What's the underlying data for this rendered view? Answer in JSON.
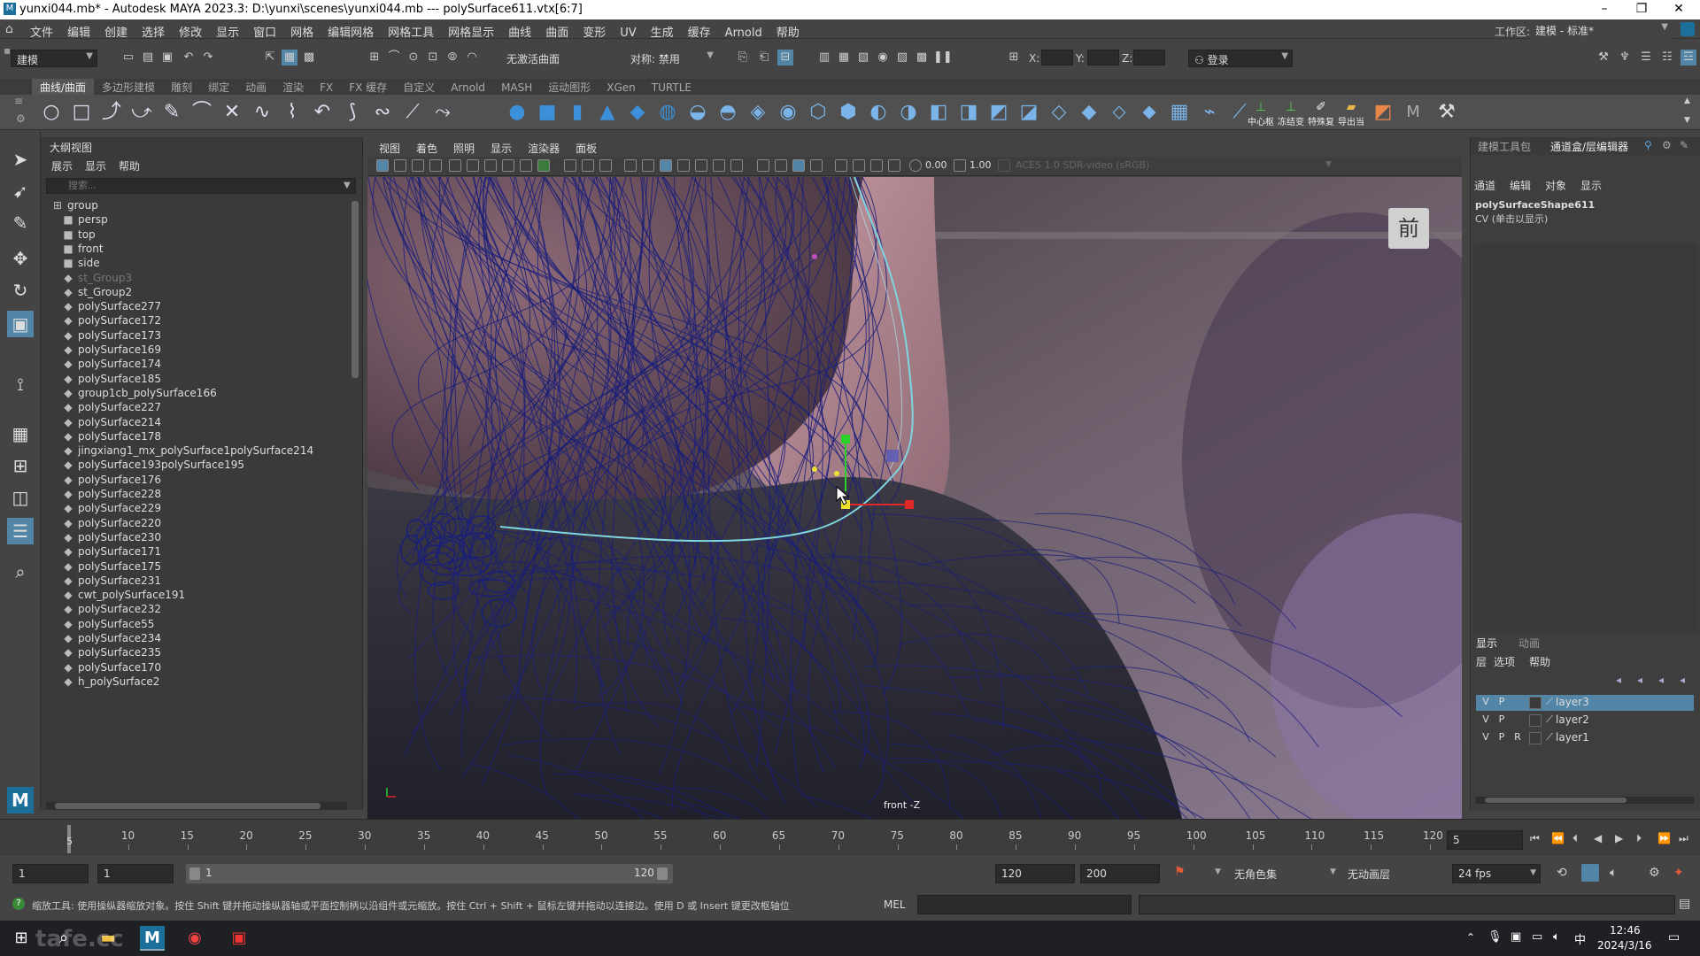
{
  "titlebar": {
    "title": "yunxi044.mb* - Autodesk MAYA 2023.3: D:\\yunxi\\scenes\\yunxi044.mb   ---   polySurface611.vtx[6:7]",
    "minimize": "–",
    "restore": "❐",
    "close": "✕"
  },
  "menubar": {
    "items": [
      "文件",
      "编辑",
      "创建",
      "选择",
      "修改",
      "显示",
      "窗口",
      "网格",
      "编辑网格",
      "网格工具",
      "网格显示",
      "曲线",
      "曲面",
      "变形",
      "UV",
      "生成",
      "缓存",
      "Arnold",
      "帮助"
    ],
    "workspace_label": "工作区:",
    "workspace_value": "建模 - 标准*"
  },
  "statusline": {
    "mode": "建模",
    "live_surface": "无激活曲面",
    "symmetry": "对称: 禁用",
    "x_label": "X:",
    "y_label": "Y:",
    "z_label": "Z:",
    "login": "登录"
  },
  "shelf_tabs": [
    "曲线/曲面",
    "多边形建模",
    "雕刻",
    "绑定",
    "动画",
    "渲染",
    "FX",
    "FX 缓存",
    "自定义",
    "Arnold",
    "MASH",
    "运动图形",
    "XGen",
    "TURTLE"
  ],
  "shelf_text_buttons": [
    "中心枢",
    "冻结变",
    "特殊复",
    "导出当"
  ],
  "outliner": {
    "title": "大纲视图",
    "menu": [
      "展示",
      "显示",
      "帮助"
    ],
    "search_placeholder": "搜索...",
    "rows": [
      {
        "label": "group",
        "type": "group"
      },
      {
        "label": "persp",
        "type": "camera"
      },
      {
        "label": "top",
        "type": "camera"
      },
      {
        "label": "front",
        "type": "camera"
      },
      {
        "label": "side",
        "type": "camera"
      },
      {
        "label": "st_Group3",
        "type": "mesh-dim"
      },
      {
        "label": "st_Group2",
        "type": "mesh"
      },
      {
        "label": "polySurface277",
        "type": "mesh"
      },
      {
        "label": "polySurface172",
        "type": "mesh"
      },
      {
        "label": "polySurface173",
        "type": "mesh"
      },
      {
        "label": "polySurface169",
        "type": "mesh"
      },
      {
        "label": "polySurface174",
        "type": "mesh"
      },
      {
        "label": "polySurface185",
        "type": "mesh"
      },
      {
        "label": "group1cb_polySurface166",
        "type": "mesh"
      },
      {
        "label": "polySurface227",
        "type": "mesh"
      },
      {
        "label": "polySurface214",
        "type": "mesh"
      },
      {
        "label": "polySurface178",
        "type": "mesh"
      },
      {
        "label": "jingxiang1_mx_polySurface1polySurface214",
        "type": "mesh"
      },
      {
        "label": "polySurface193polySurface195",
        "type": "mesh"
      },
      {
        "label": "polySurface176",
        "type": "mesh"
      },
      {
        "label": "polySurface228",
        "type": "mesh"
      },
      {
        "label": "polySurface229",
        "type": "mesh"
      },
      {
        "label": "polySurface220",
        "type": "mesh"
      },
      {
        "label": "polySurface230",
        "type": "mesh"
      },
      {
        "label": "polySurface171",
        "type": "mesh"
      },
      {
        "label": "polySurface175",
        "type": "mesh"
      },
      {
        "label": "polySurface231",
        "type": "mesh"
      },
      {
        "label": "cwt_polySurface191",
        "type": "mesh"
      },
      {
        "label": "polySurface232",
        "type": "mesh"
      },
      {
        "label": "polySurface55",
        "type": "mesh"
      },
      {
        "label": "polySurface234",
        "type": "mesh"
      },
      {
        "label": "polySurface235",
        "type": "mesh"
      },
      {
        "label": "polySurface170",
        "type": "mesh"
      },
      {
        "label": "h_polySurface2",
        "type": "mesh"
      }
    ]
  },
  "viewport": {
    "menu": [
      "视图",
      "着色",
      "照明",
      "显示",
      "渲染器",
      "面板"
    ],
    "exposure": "0.00",
    "gamma": "1.00",
    "color_space": "ACES 1.0 SDR-video (sRGB)",
    "camera_label": "front -Z",
    "view_cube": "前"
  },
  "right_panel": {
    "tabs": [
      "建模工具包",
      "通道盒/层编辑器"
    ],
    "cb_menu": [
      "通道",
      "编辑",
      "对象",
      "显示"
    ],
    "object_name": "polySurfaceShape611",
    "component": "CV (单击以显示)",
    "layer_tabs": [
      "显示",
      "动画"
    ],
    "layer_menu": [
      "层",
      "选项",
      "帮助"
    ],
    "layers": [
      {
        "v": "V",
        "p": "P",
        "r": "",
        "name": "layer3",
        "selected": true
      },
      {
        "v": "V",
        "p": "P",
        "r": "",
        "name": "layer2",
        "selected": false
      },
      {
        "v": "V",
        "p": "P",
        "r": "R",
        "name": "layer1",
        "selected": false
      }
    ]
  },
  "timeline": {
    "ticks": [
      "5",
      "10",
      "15",
      "20",
      "25",
      "30",
      "35",
      "40",
      "45",
      "50",
      "55",
      "60",
      "65",
      "70",
      "75",
      "80",
      "85",
      "90",
      "95",
      "100",
      "105",
      "110",
      "115",
      "120"
    ],
    "current_frame": "5",
    "current_frame_marker": "5"
  },
  "range": {
    "start": "1",
    "playback_start": "1",
    "slider_start": "1",
    "slider_end": "120",
    "playback_end": "120",
    "end": "200",
    "character_set": "无角色集",
    "anim_layer": "无动画层",
    "fps": "24 fps"
  },
  "cmdline": {
    "help": "缩放工具: 使用操纵器缩放对象。按住 Shift 键并拖动操纵器轴或平面控制柄以沿组件或元缩放。按住 Ctrl + Shift + 鼠标左键并拖动以连接边。使用 D 或 Insert 键更改枢轴位",
    "lang": "MEL"
  },
  "taskbar": {
    "time": "12:46",
    "date": "2024/3/16",
    "ime": "中",
    "watermark": "tafe.cc"
  },
  "colors": {
    "wire": "#1a1f7a",
    "curve": "#7fd6e0",
    "selected_layer": "#5285a6"
  }
}
